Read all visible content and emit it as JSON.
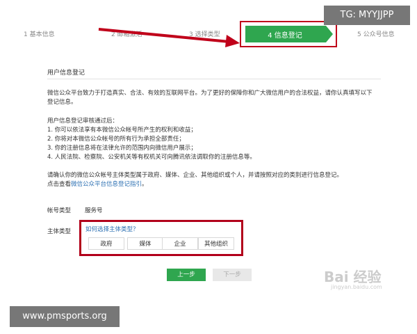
{
  "watermarks": {
    "top_right": "TG: MYYJJPP",
    "bottom_left": "www.pmsports.org"
  },
  "steps": [
    {
      "label": "1 基本信息"
    },
    {
      "label": "2 邮箱激活"
    },
    {
      "label": "3 选择类型"
    },
    {
      "label": "4 信息登记"
    },
    {
      "label": "5 公众号信息"
    }
  ],
  "form": {
    "section_title": "用户信息登记",
    "intro": "微信公众平台致力于打造真实、合法、有效的互联网平台。为了更好的保障你和广大微信用户的合法权益，请你认真填写以下登记信息。",
    "rights_title": "用户信息登记审核通过后：",
    "rights": [
      "1. 你可以依法享有本微信公众帐号所产生的权利和收益；",
      "2. 你将对本微信公众帐号的所有行为承担全部责任；",
      "3. 你的注册信息将在法律允许的范围内向微信用户展示；",
      "4. 人民法院、检察院、公安机关等有权机关可向腾讯依法调取你的注册信息等。"
    ],
    "confirm_text": "请确认你的微信公众帐号主体类型属于政府、媒体、企业、其他组织或个人，并请按照对应的类别进行信息登记。",
    "guide_prefix": "点击查看",
    "guide_link": "微信公众平台信息登记指引",
    "guide_suffix": "。",
    "account_type_label": "帐号类型",
    "account_type_value": "服务号",
    "entity_type_label": "主体类型",
    "entity_hint": "如何选择主体类型？",
    "entity_options": [
      "政府",
      "媒体",
      "企业",
      "其他组织"
    ],
    "prev_button": "上一步",
    "next_button": "下一步"
  },
  "baidu_watermark": {
    "text": "Bai 经验",
    "sub": "jingyan.baidu.com"
  },
  "colors": {
    "active_step": "#2fa64f",
    "highlight_border": "#b2001b",
    "link": "#2b6fb2"
  }
}
